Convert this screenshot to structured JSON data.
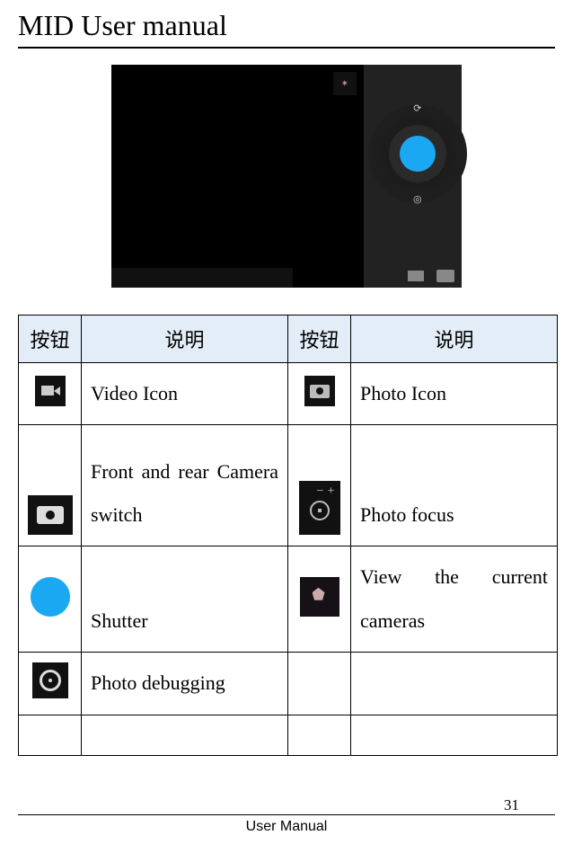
{
  "header": {
    "title": "MID User manual"
  },
  "screenshot": {
    "preview_thumb_glyph": "✶"
  },
  "table": {
    "col_button_1": "按钮",
    "col_desc_1": "说明",
    "col_button_2": "按钮",
    "col_desc_2": "说明",
    "rows": [
      {
        "desc1": "Video Icon",
        "desc2": "Photo Icon"
      },
      {
        "desc1": "Front and rear Camera switch",
        "desc2": "Photo focus"
      },
      {
        "desc1": "Shutter",
        "desc2": "View the current cameras"
      },
      {
        "desc1": "Photo debugging",
        "desc2": ""
      },
      {
        "desc1": "",
        "desc2": ""
      }
    ]
  },
  "footer": {
    "page_number": "31",
    "label": "User Manual"
  }
}
